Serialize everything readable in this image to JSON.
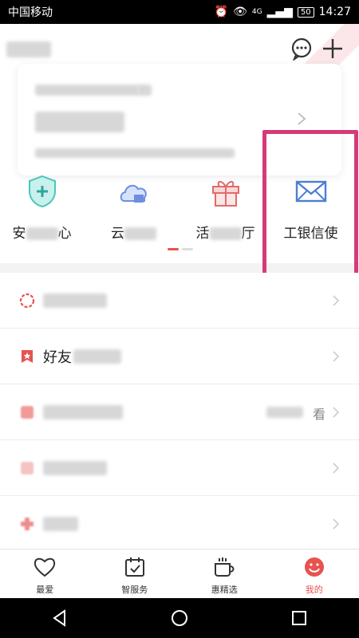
{
  "status_bar": {
    "carrier": "中国移动",
    "network": "4G",
    "battery": "50",
    "time": "14:27"
  },
  "header": {
    "chat_icon": "chat-bubble-icon",
    "add_icon": "plus-icon"
  },
  "quick_actions": [
    {
      "label_visible_start": "安",
      "label_visible_end": "心",
      "icon": "shield-plus-icon"
    },
    {
      "label_visible_start": "云",
      "label_visible_end": "",
      "icon": "cloud-icon"
    },
    {
      "label_visible_start": "活",
      "label_visible_end": "厅",
      "icon": "gift-icon"
    },
    {
      "label": "工银信使",
      "icon": "envelope-icon"
    }
  ],
  "list_items": [
    {
      "label": "",
      "icon": "circle-dash-icon"
    },
    {
      "label_visible": "好友",
      "icon": "bookmark-star-icon"
    },
    {
      "label": "",
      "right_text_visible": "看",
      "icon": "red-square-icon"
    },
    {
      "label": "",
      "icon": "pink-square-icon"
    },
    {
      "label": "",
      "icon": "red-cross-icon"
    }
  ],
  "tabs": [
    {
      "label": "最爱",
      "icon": "heart-icon",
      "active": false
    },
    {
      "label": "智服务",
      "icon": "calendar-check-icon",
      "active": false
    },
    {
      "label": "惠精选",
      "icon": "coffee-cup-icon",
      "active": false
    },
    {
      "label": "我的",
      "icon": "smiley-icon",
      "active": true
    }
  ],
  "colors": {
    "accent": "#e8524f",
    "highlight": "#d63a78",
    "envelope_blue": "#4a7fd6"
  }
}
